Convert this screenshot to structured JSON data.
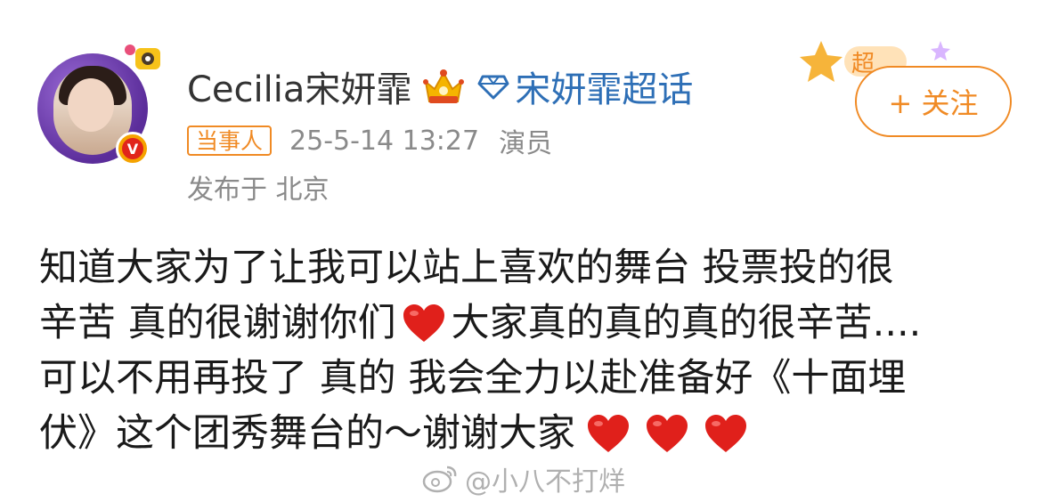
{
  "user": {
    "name": "Cecilia宋妍霏",
    "super_topic": "宋妍霏超话"
  },
  "meta": {
    "badge": "当事人",
    "timestamp": "25-5-14 13:27",
    "role": "演员",
    "location": "发布于 北京"
  },
  "follow": {
    "label": "+ 关注",
    "deco_text": "超"
  },
  "post": {
    "line1": "知道大家为了让我可以站上喜欢的舞台 投票投的很",
    "line2a": "辛苦 真的很谢谢你们",
    "line2b": "大家真的真的真的很辛苦....",
    "line3": "可以不用再投了 真的  我会全力以赴准备好《十面埋",
    "line4": "伏》这个团秀舞台的～谢谢大家"
  },
  "watermark": {
    "text": "@小八不打烊"
  },
  "icons": {
    "avatar": "avatar-photo",
    "verified": "verified-v-icon",
    "crown": "crown-badge-icon",
    "diamond": "diamond-icon",
    "heart": "red-heart-icon",
    "weibo": "weibo-logo-icon"
  },
  "colors": {
    "accent_orange": "#f08a24",
    "link_blue": "#2e6fb6",
    "meta_gray": "#8a8a8a",
    "heart_red": "#e0201b"
  }
}
